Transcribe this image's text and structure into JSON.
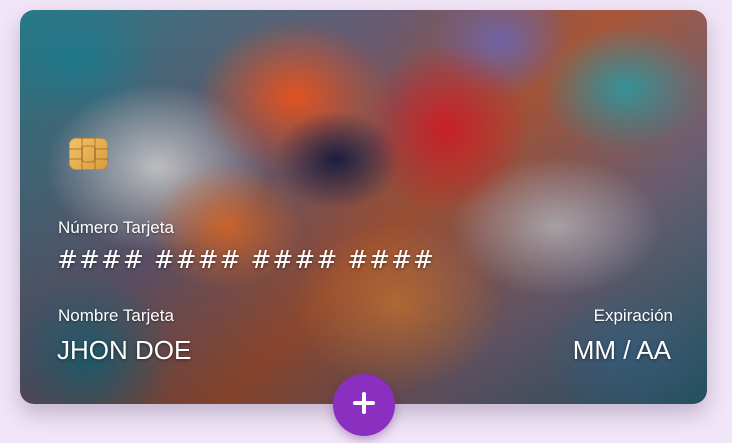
{
  "card": {
    "number_label": "Número Tarjeta",
    "number_value": "#### #### #### ####",
    "name_label": "Nombre Tarjeta",
    "name_value": "JHON DOE",
    "expiry_label": "Expiración",
    "expiry_value": "MM / AA"
  },
  "icons": {
    "chip": "card-chip-icon",
    "add": "plus-icon"
  },
  "colors": {
    "page_background": "#f1e6f7",
    "add_button": "#8b2fc0",
    "chip": "#e8b557",
    "text": "#ffffff"
  }
}
